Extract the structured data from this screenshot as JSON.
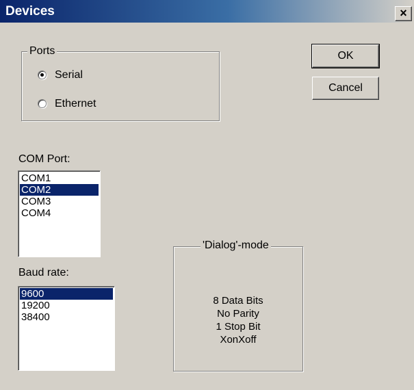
{
  "window": {
    "title": "Devices",
    "close_glyph": "×"
  },
  "ports": {
    "legend": "Ports",
    "options": [
      {
        "label": "Serial",
        "selected": true
      },
      {
        "label": "Ethernet",
        "selected": false
      }
    ]
  },
  "buttons": {
    "ok": "OK",
    "cancel": "Cancel"
  },
  "com_port": {
    "label": "COM Port:",
    "items": [
      "COM1",
      "COM2",
      "COM3",
      "COM4"
    ],
    "selected": "COM2"
  },
  "baud_rate": {
    "label": "Baud rate:",
    "items": [
      "9600",
      "19200",
      "38400"
    ],
    "selected": "9600"
  },
  "dialog_mode": {
    "legend": "'Dialog'-mode",
    "lines": [
      "8 Data Bits",
      "No Parity",
      "1 Stop Bit",
      "XonXoff"
    ]
  },
  "colors": {
    "title_bar": "#0a246a",
    "selection": "#0a246a",
    "dialog_face": "#d4d0c8"
  }
}
